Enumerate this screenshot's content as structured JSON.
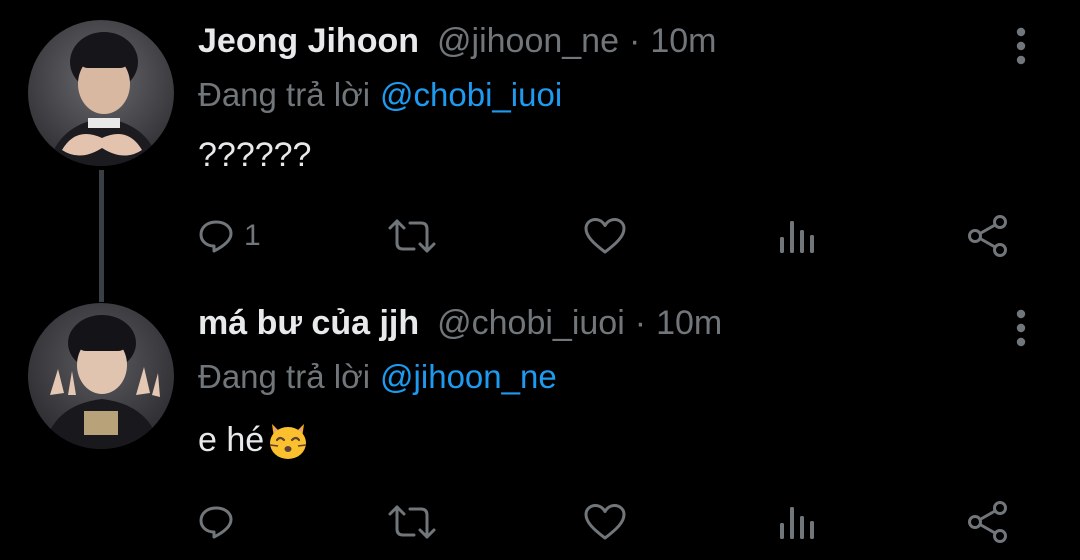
{
  "tweets": [
    {
      "display_name": "Jeong Jihoon",
      "handle": "@jihoon_ne",
      "separator": "·",
      "time": "10m",
      "reply_prefix": "Đang trả lời",
      "reply_to": "@chobi_iuoi",
      "text": "??????",
      "reply_count": "1",
      "avatar": "avatar-photo"
    },
    {
      "display_name": "má bư của jjh",
      "handle": "@chobi_iuoi",
      "separator": "·",
      "time": "10m",
      "reply_prefix": "Đang trả lời",
      "reply_to": "@jihoon_ne",
      "text": "e hé",
      "emoji": "kissing-cat-emoji",
      "reply_count": "",
      "avatar": "avatar-photo"
    }
  ],
  "icons": {
    "more": "more-vertical-icon",
    "reply": "reply-icon",
    "retweet": "retweet-icon",
    "like": "heart-icon",
    "views": "views-icon",
    "share": "share-icon"
  },
  "colors": {
    "background": "#000000",
    "primary_text": "#e7e9ea",
    "secondary_text": "#71767b",
    "link": "#1d9bf0",
    "thread_line": "#3a3f44"
  }
}
